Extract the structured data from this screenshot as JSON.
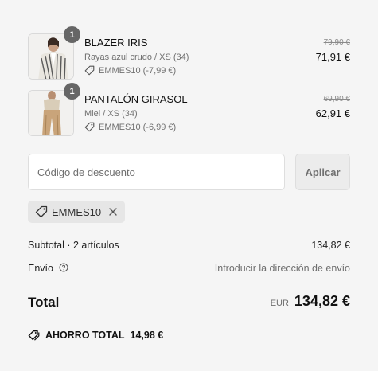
{
  "items": [
    {
      "quantity": "1",
      "name": "BLAZER IRIS",
      "variant": "Rayas azul crudo / XS (34)",
      "discount": "EMMES10 (-7,99 €)",
      "price_original": "79,90 €",
      "price_final": "71,91 €",
      "icons": [
        "product-thumbnail",
        "tag-icon"
      ]
    },
    {
      "quantity": "1",
      "name": "PANTALÓN GIRASOL",
      "variant": "Miel / XS (34)",
      "discount": "EMMES10 (-6,99 €)",
      "price_original": "69,90 €",
      "price_final": "62,91 €",
      "icons": [
        "product-thumbnail",
        "tag-icon"
      ]
    }
  ],
  "discount_form": {
    "placeholder": "Código de descuento",
    "value": "",
    "apply_label": "Aplicar"
  },
  "applied_code": {
    "code": "EMMES10",
    "icons": [
      "tag-icon",
      "close-icon"
    ]
  },
  "summary": {
    "subtotal_label": "Subtotal · 2 artículos",
    "subtotal_value": "134,82 €",
    "shipping_label": "Envío",
    "shipping_value": "Introducir la dirección de envío",
    "total_label": "Total",
    "currency": "EUR",
    "total_value": "134,82 €",
    "savings_label": "AHORRO TOTAL",
    "savings_value": "14,98 €"
  },
  "colors": {
    "background": "#f5f5f5",
    "badge": "#666666",
    "chip": "#e6e6e6",
    "muted_text": "#6e6e6e"
  }
}
